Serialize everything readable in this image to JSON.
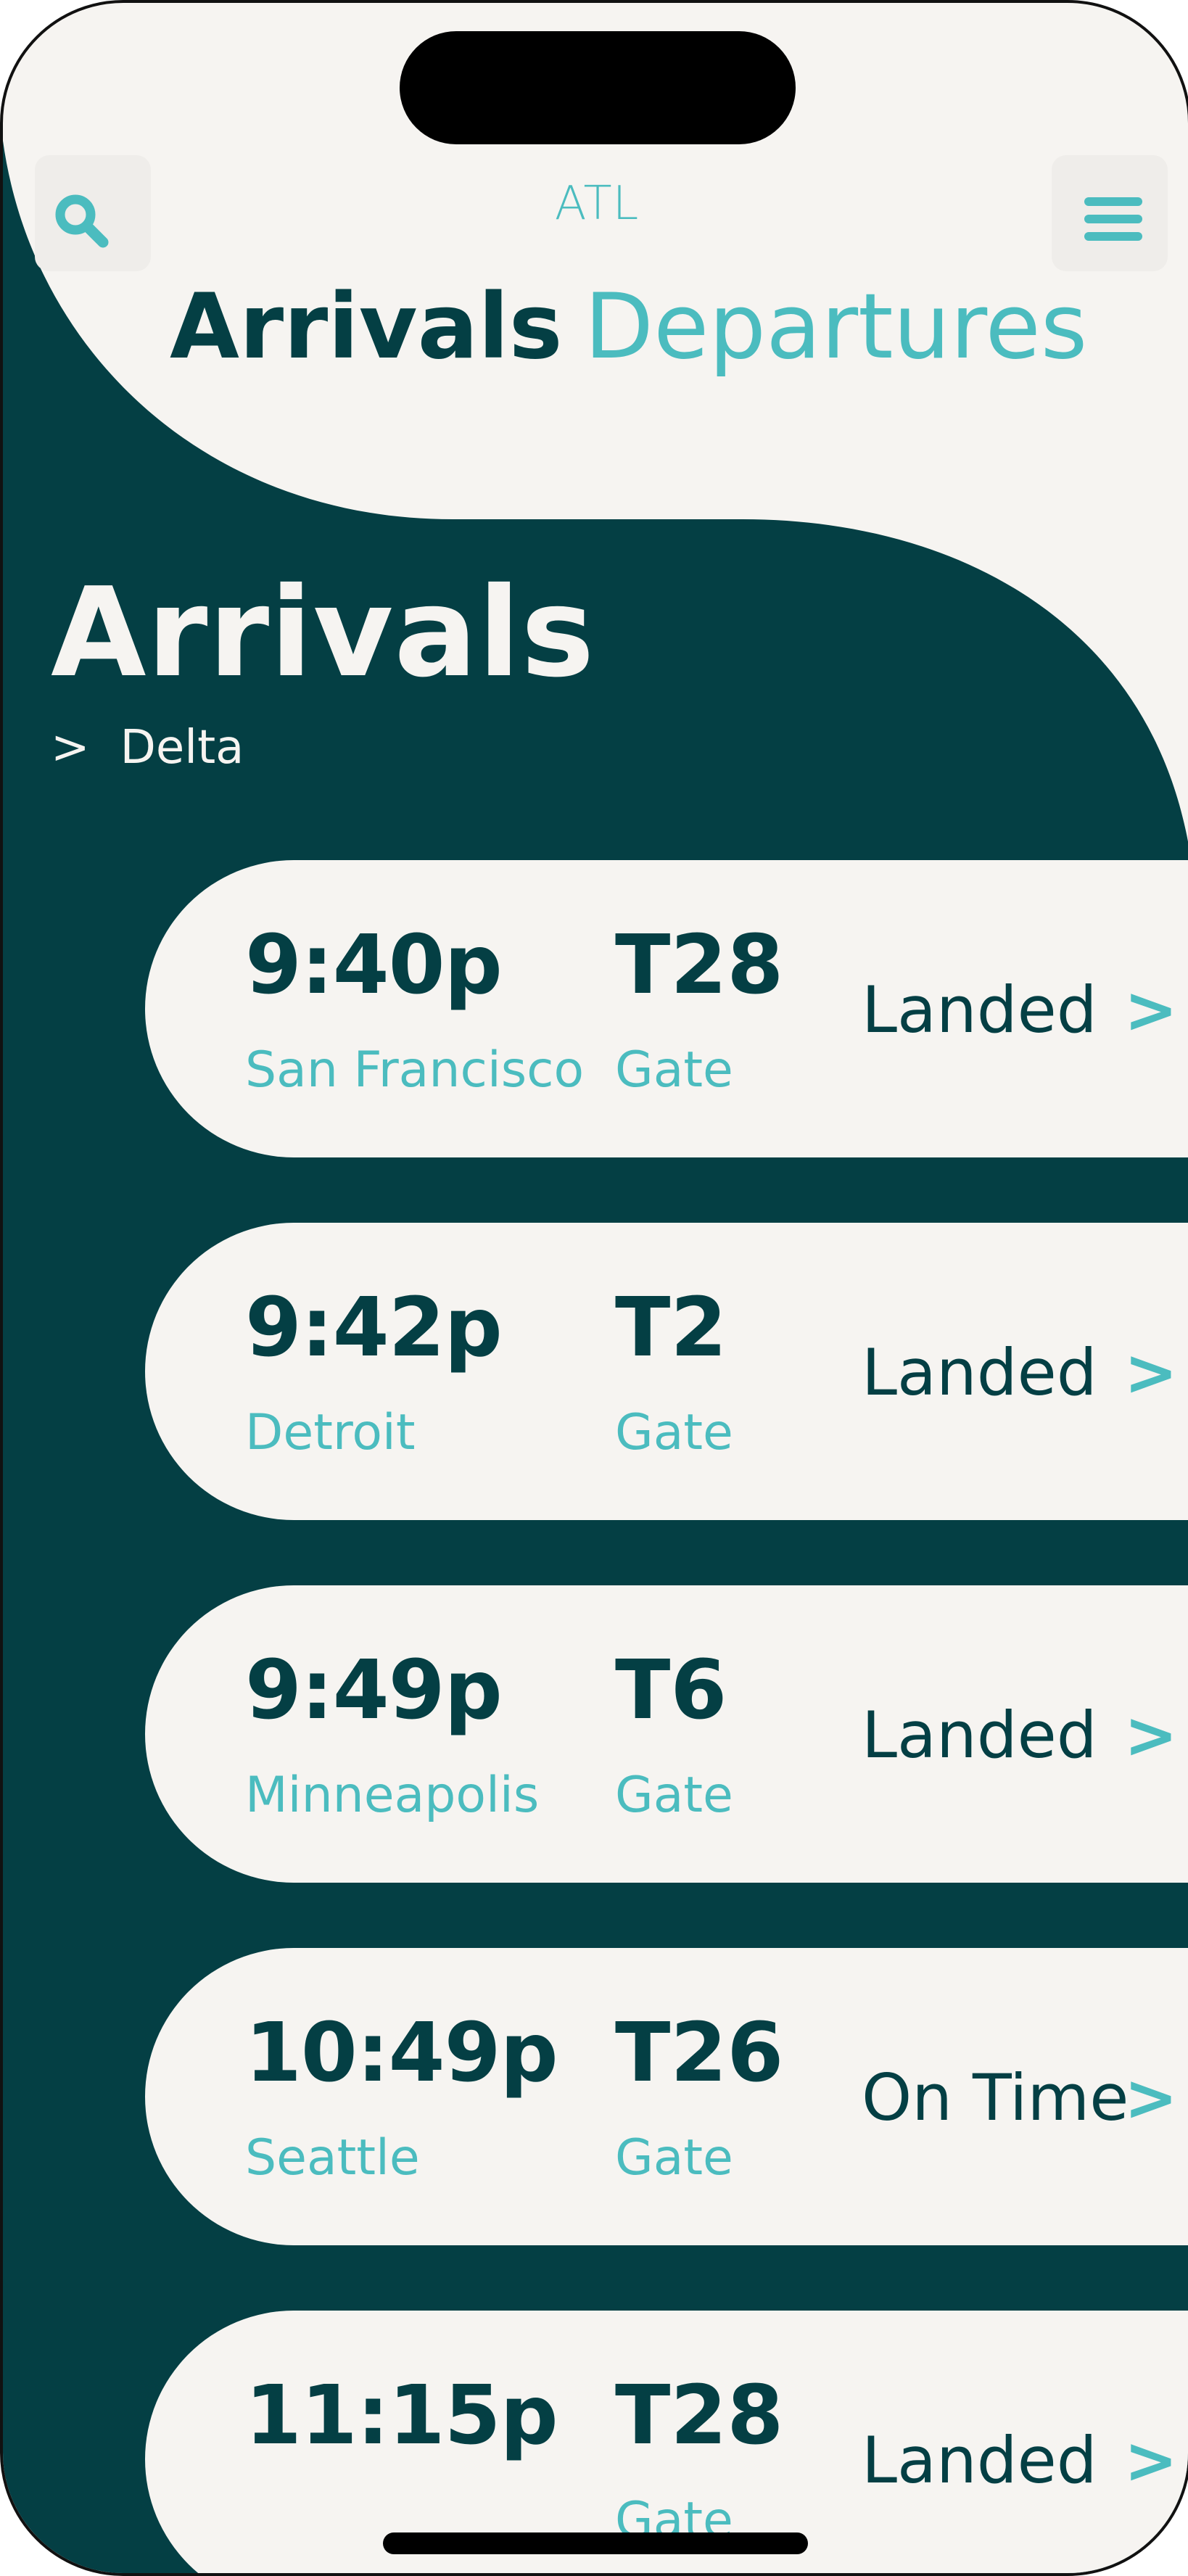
{
  "header": {
    "airport_code": "ATL",
    "tabs": [
      {
        "label": "Arrivals",
        "active": true
      },
      {
        "label": "Departures",
        "active": false
      }
    ]
  },
  "section": {
    "title": "Arrivals",
    "filter_chevron": ">",
    "filter_label": "Delta"
  },
  "flights": [
    {
      "time": "9:40p",
      "city": "San Francisco",
      "gate": "T28",
      "gate_label": "Gate",
      "status": "Landed",
      "chevron": ">"
    },
    {
      "time": "9:42p",
      "city": "Detroit",
      "gate": "T2",
      "gate_label": "Gate",
      "status": "Landed",
      "chevron": ">"
    },
    {
      "time": "9:49p",
      "city": "Minneapolis",
      "gate": "T6",
      "gate_label": "Gate",
      "status": "Landed",
      "chevron": ">"
    },
    {
      "time": "10:49p",
      "city": "Seattle",
      "gate": "T26",
      "gate_label": "Gate",
      "status": "On Time",
      "chevron": ">"
    },
    {
      "time": "11:15p",
      "city": "",
      "gate": "T28",
      "gate_label": "Gate",
      "status": "Landed",
      "chevron": ">"
    }
  ],
  "icons": {
    "search": "search-icon",
    "menu": "hamburger-menu-icon"
  },
  "colors": {
    "dark_teal": "#043f44",
    "accent_teal": "#4bbcbf",
    "background": "#f6f4f1"
  }
}
